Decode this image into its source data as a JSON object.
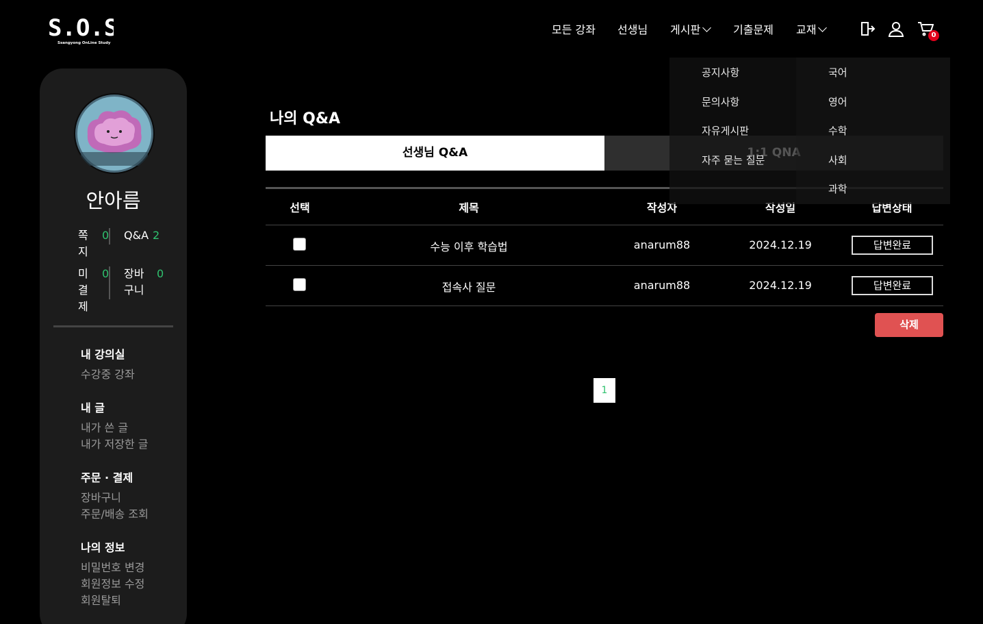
{
  "header": {
    "logo_text": "S.O.S",
    "logo_subtext": "Ssangyong OnLine Study",
    "nav": [
      "모든 강좌",
      "선생님",
      "게시판",
      "기출문제",
      "교재"
    ],
    "cart_count": "0"
  },
  "dropdown": {
    "board": [
      "공지사항",
      "문의사항",
      "자유게시판",
      "자주 묻는 질문"
    ],
    "books": [
      "국어",
      "영어",
      "수학",
      "사회",
      "과학"
    ]
  },
  "sidebar": {
    "user_name": "안아름",
    "stats": {
      "note_label": "쪽지",
      "note_value": "0",
      "qa_label": "Q&A",
      "qa_value": "2",
      "unpaid_label": "미결제",
      "unpaid_value": "0",
      "cart_label": "장바구니",
      "cart_value": "0"
    },
    "sections": [
      {
        "title": "내 강의실",
        "links": [
          "수강중 강좌"
        ]
      },
      {
        "title": "내 글",
        "links": [
          "내가 쓴 글",
          "내가 저장한 글"
        ]
      },
      {
        "title": "주문 · 결제",
        "links": [
          "장바구니",
          "주문/배송 조회"
        ]
      },
      {
        "title": "나의 정보",
        "links": [
          "비밀번호 변경",
          "회원정보 수정",
          "회원탈퇴"
        ]
      }
    ]
  },
  "main": {
    "title": "나의 Q&A",
    "tabs": [
      "선생님 Q&A",
      "1:1 QNA"
    ],
    "columns": [
      "선택",
      "제목",
      "작성자",
      "작성일",
      "답변상태"
    ],
    "rows": [
      {
        "title": "수능 이후 학습법",
        "author": "anarum88",
        "date": "2024.12.19",
        "status": "답변완료"
      },
      {
        "title": "접속사 질문",
        "author": "anarum88",
        "date": "2024.12.19",
        "status": "답변완료"
      }
    ],
    "delete_label": "삭제",
    "current_page": "1"
  },
  "colors": {
    "background": "#000000",
    "sidebar": "#1c1c1c",
    "accent_green": "#2fc26f",
    "delete_red": "#e05252",
    "badge_red": "#e3001b"
  },
  "icons": [
    "logout-icon",
    "user-icon",
    "cart-icon"
  ]
}
